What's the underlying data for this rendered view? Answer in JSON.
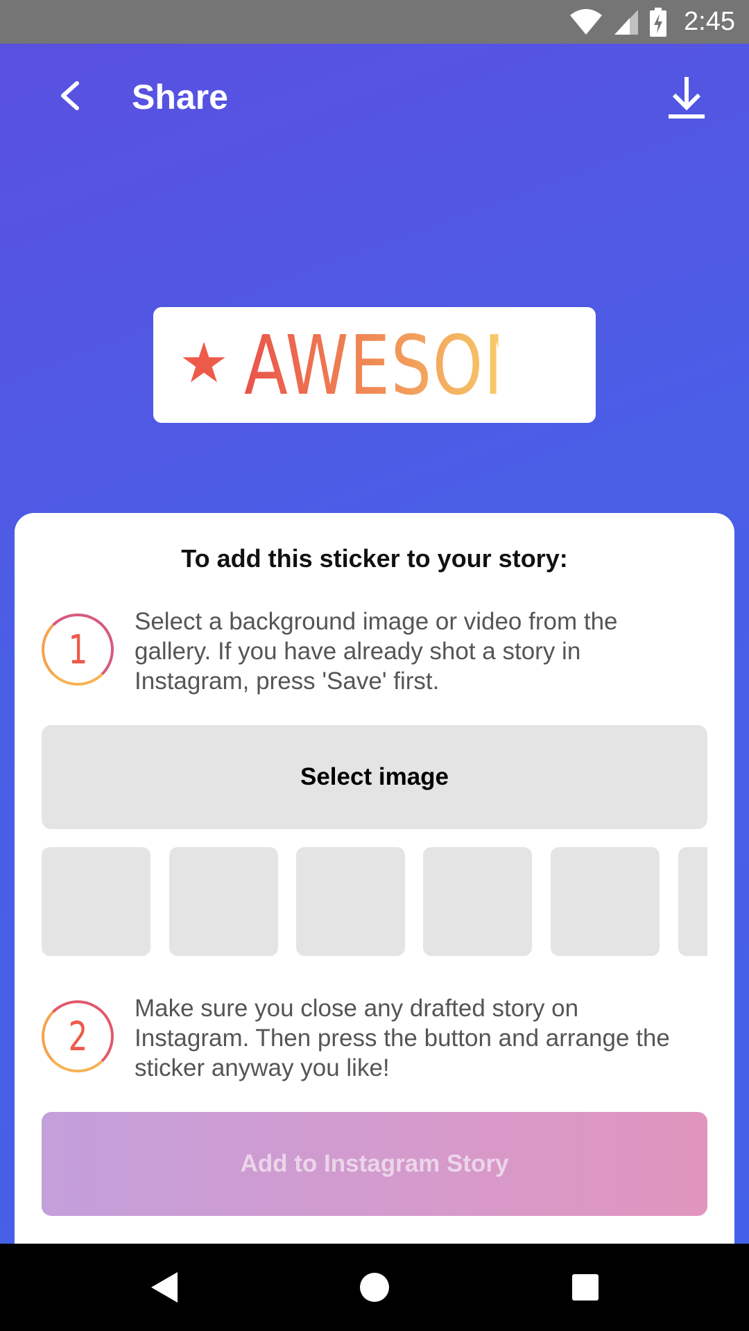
{
  "status_bar": {
    "time": "2:45",
    "icons": [
      "wifi-icon",
      "signal-icon",
      "battery-charging-icon"
    ]
  },
  "app_bar": {
    "title": "Share",
    "back_icon": "back-arrow-icon",
    "download_icon": "download-icon"
  },
  "sticker": {
    "star_icon": "star-icon",
    "text": "AWESOME",
    "colors": [
      "#e9534a",
      "#f08a55",
      "#f7c967"
    ]
  },
  "card": {
    "heading": "To add this sticker to your story:",
    "step1": {
      "number": "1",
      "text": "Select a background image or video from the gallery. If you have already shot a story in Instagram, press  'Save' first."
    },
    "select_button": "Select image",
    "thumbnails": [
      "",
      "",
      "",
      "",
      "",
      ""
    ],
    "step2": {
      "number": "2",
      "text": "Make sure you close any drafted story on Instagram. Then press the button and arrange the sticker anyway you like!"
    },
    "add_button": "Add to Instagram Story"
  },
  "nav_bar": {
    "icons": [
      "nav-back-icon",
      "nav-home-icon",
      "nav-recents-icon"
    ]
  },
  "colors": {
    "background_gradient": [
      "#5b4fe0",
      "#4560e8"
    ],
    "accent": "#ee5a4a",
    "disabled_button_gradient": [
      "#c39fdb",
      "#e095bd"
    ]
  }
}
